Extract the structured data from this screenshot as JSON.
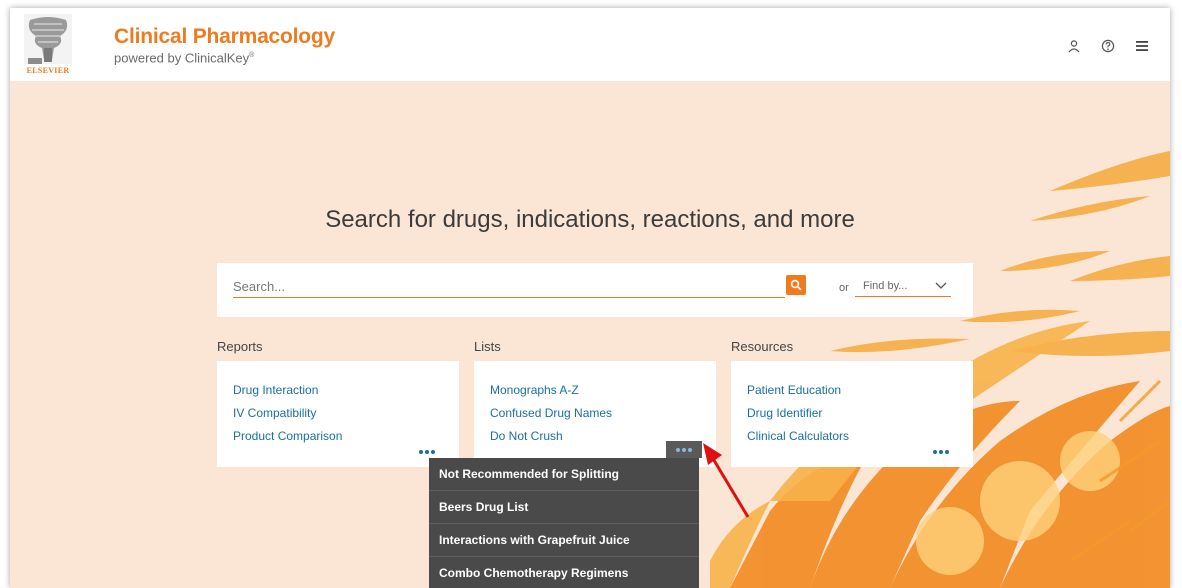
{
  "brand": {
    "title": "Clinical Pharmacology",
    "subtitle": "powered by ClinicalKey",
    "trademark": "®",
    "publisher": "ELSEVIER"
  },
  "header_icons": [
    "user-icon",
    "help-icon",
    "hamburger-menu-icon"
  ],
  "search": {
    "headline": "Search for drugs, indications, reactions, and more",
    "placeholder": "Search...",
    "or_label": "or",
    "find_by_label": "Find by..."
  },
  "sections": {
    "reports": {
      "title": "Reports",
      "items": [
        "Drug Interaction",
        "IV Compatibility",
        "Product Comparison"
      ]
    },
    "lists": {
      "title": "Lists",
      "items": [
        "Monographs A-Z",
        "Confused Drug Names",
        "Do Not Crush"
      ]
    },
    "resources": {
      "title": "Resources",
      "items": [
        "Patient Education",
        "Drug Identifier",
        "Clinical Calculators"
      ]
    }
  },
  "more_menu": {
    "items": [
      "Not Recommended for Splitting",
      "Beers Drug List",
      "Interactions with Grapefruit Juice",
      "Combo Chemotherapy Regimens"
    ]
  },
  "colors": {
    "brand_orange": "#f07b1e",
    "hero_background": "#fbe6d6",
    "link_blue": "#1a6fa0",
    "menu_background": "#4a4a4a",
    "annotation_arrow": "#e01010"
  }
}
